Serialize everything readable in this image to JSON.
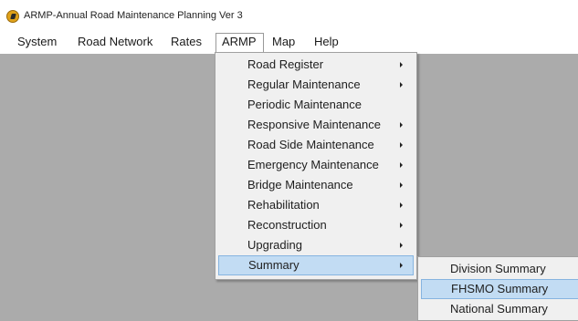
{
  "window": {
    "title": "ARMP-Annual Road Maintenance Planning Ver 3",
    "icon": "app-logo-icon"
  },
  "menubar": {
    "items": [
      {
        "label": "System"
      },
      {
        "label": "Road Network"
      },
      {
        "label": "Rates"
      },
      {
        "label": "ARMP"
      },
      {
        "label": "Map"
      },
      {
        "label": "Help"
      }
    ],
    "active": "ARMP"
  },
  "armp_menu": {
    "items": [
      {
        "label": "Road Register",
        "has_submenu": true
      },
      {
        "label": "Regular Maintenance",
        "has_submenu": true
      },
      {
        "label": "Periodic Maintenance",
        "has_submenu": false
      },
      {
        "label": "Responsive Maintenance",
        "has_submenu": true
      },
      {
        "label": "Road Side Maintenance",
        "has_submenu": true
      },
      {
        "label": "Emergency Maintenance",
        "has_submenu": true
      },
      {
        "label": "Bridge Maintenance",
        "has_submenu": true
      },
      {
        "label": "Rehabilitation",
        "has_submenu": true
      },
      {
        "label": "Reconstruction",
        "has_submenu": true
      },
      {
        "label": "Upgrading",
        "has_submenu": true
      },
      {
        "label": "Summary",
        "has_submenu": true
      }
    ],
    "highlighted": "Summary"
  },
  "summary_submenu": {
    "items": [
      {
        "label": "Division Summary"
      },
      {
        "label": "FHSMO Summary"
      },
      {
        "label": "National Summary"
      }
    ],
    "highlighted": "FHSMO Summary"
  },
  "colors": {
    "workspace": "#ababab",
    "menu_bg": "#f0f0f0",
    "highlight": "#c2dcf3",
    "highlight_border": "#86b4e0"
  }
}
